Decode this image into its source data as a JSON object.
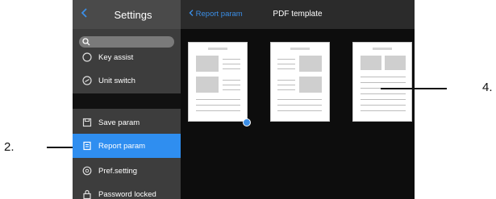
{
  "callouts": {
    "left": "2.",
    "right": "4."
  },
  "sidebar": {
    "title": "Settings",
    "back_icon": "chevron-left-icon",
    "search_icon": "search-icon",
    "items": [
      {
        "label": "Key assist",
        "icon": "key-icon"
      },
      {
        "label": "Unit switch",
        "icon": "unit-icon"
      },
      {
        "label": "Save param",
        "icon": "save-icon"
      },
      {
        "label": "Report param",
        "icon": "report-icon",
        "active": true
      },
      {
        "label": "Pref.setting",
        "icon": "settings-icon"
      },
      {
        "label": "Password locked",
        "icon": "lock-icon"
      }
    ]
  },
  "main": {
    "back_label": "Report param",
    "title": "PDF template",
    "templates": [
      {
        "name": "template-1",
        "selected": true
      },
      {
        "name": "template-2",
        "selected": false
      },
      {
        "name": "template-3",
        "selected": false
      }
    ]
  },
  "colors": {
    "accent": "#2f8ef0",
    "sidebar_bg": "#3d3d3d",
    "main_bg": "#0d0d0d"
  }
}
